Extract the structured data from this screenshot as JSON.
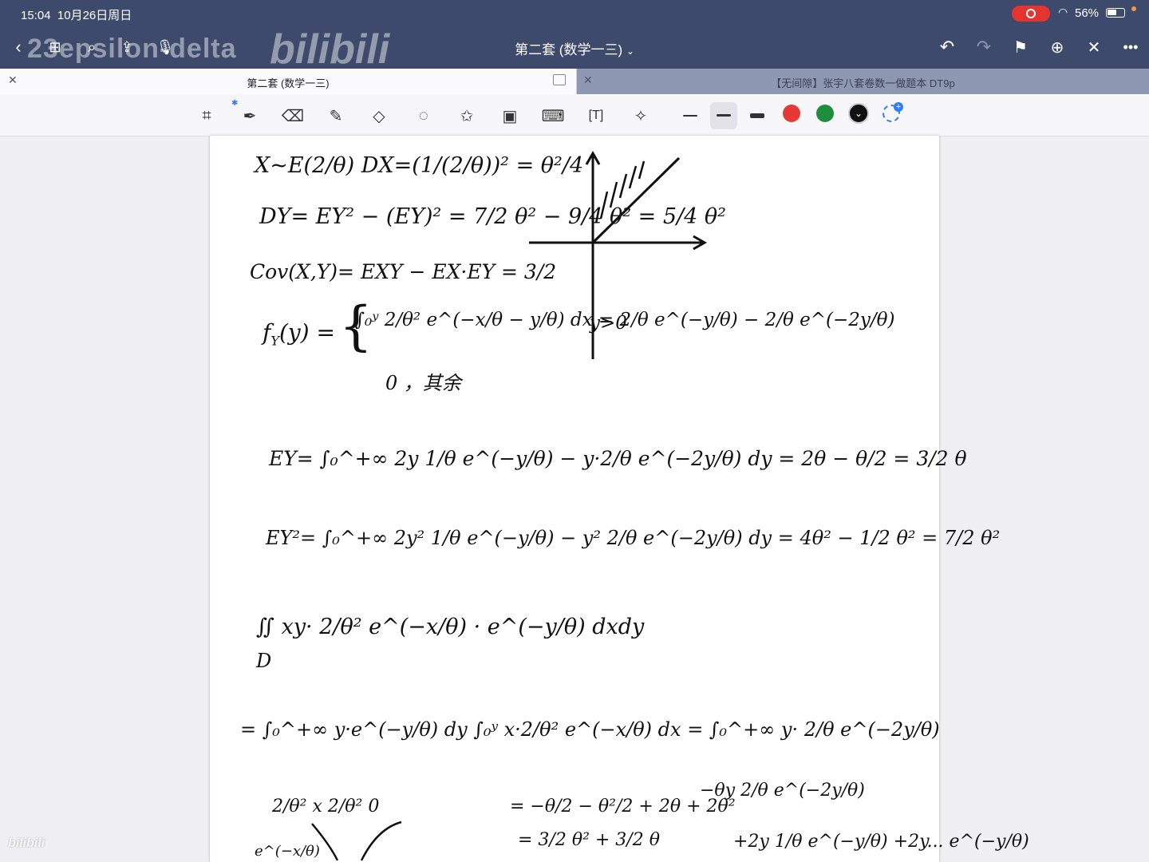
{
  "status": {
    "time": "15:04",
    "date": "10月26日周日",
    "battery": "56%"
  },
  "nav": {
    "title": "第二套 (数学一三)",
    "chevron": "⌄"
  },
  "watermark": {
    "user": "23epsilon-delta",
    "brand": "bilibili"
  },
  "tabs": [
    {
      "label": "第二套 (数学一三)",
      "active": true
    },
    {
      "label": "【无间隙】张宇八套卷数一做题本 DT9p",
      "active": false
    }
  ],
  "toolbar": {
    "tools": [
      "handwriting-zoom-icon",
      "pen-icon",
      "eraser-icon",
      "highlighter-icon",
      "shapes-icon",
      "lasso-icon",
      "sticker-icon",
      "image-icon",
      "keyboard-icon",
      "textbox-icon",
      "laser-pointer-icon"
    ],
    "stroke_widths": [
      "thin",
      "medium",
      "thick"
    ],
    "colors": [
      "#e53935",
      "#1e8e3e",
      "#111111"
    ],
    "selected_color": "#111111"
  },
  "notes": {
    "l1": "X~E(2/θ)   DX=(1/(2/θ))² = θ²/4",
    "l2": "DY= EY² − (EY)² = 7/2 θ² − 9/4 θ² = 5/4 θ²",
    "l3": "Cov(X,Y)= EXY − EX·EY = 3/2",
    "l4a": "f",
    "l4b": "Y",
    "l4c": "(y) =",
    "l4d": "∫₀ʸ 2/θ² e^(−x/θ − y/θ) dx = 2/θ e^(−y/θ) − 2/θ e^(−2y/θ)",
    "l4e": "y>0",
    "l4f": "0 ，其余",
    "l5": "EY= ∫₀^+∞ 2y 1/θ e^(−y/θ) − y·2/θ e^(−2y/θ) dy = 2θ − θ/2 = 3/2 θ",
    "l6": "EY²= ∫₀^+∞ 2y² 1/θ e^(−y/θ) − y² 2/θ e^(−2y/θ) dy = 4θ² − 1/2 θ² = 7/2 θ²",
    "l7": "∬ xy· 2/θ² e^(−x/θ) · e^(−y/θ) dxdy",
    "l7d": "D",
    "l8": "= ∫₀^+∞ y·e^(−y/θ) dy ∫₀ʸ x·2/θ² e^(−x/θ) dx = ∫₀^+∞ y· 2/θ e^(−2y/θ)",
    "l9a": "2/θ² x      2/θ²      0",
    "l9b": "= −θ/2 − θ²/2 + 2θ + 2θ²",
    "l9c": "−θy 2/θ e^(−2y/θ)",
    "l10a": "= 3/2 θ² + 3/2 θ",
    "l10b": "+2y 1/θ e^(−y/θ) +2y... e^(−y/θ)",
    "l10c": "e^(−x/θ)"
  }
}
